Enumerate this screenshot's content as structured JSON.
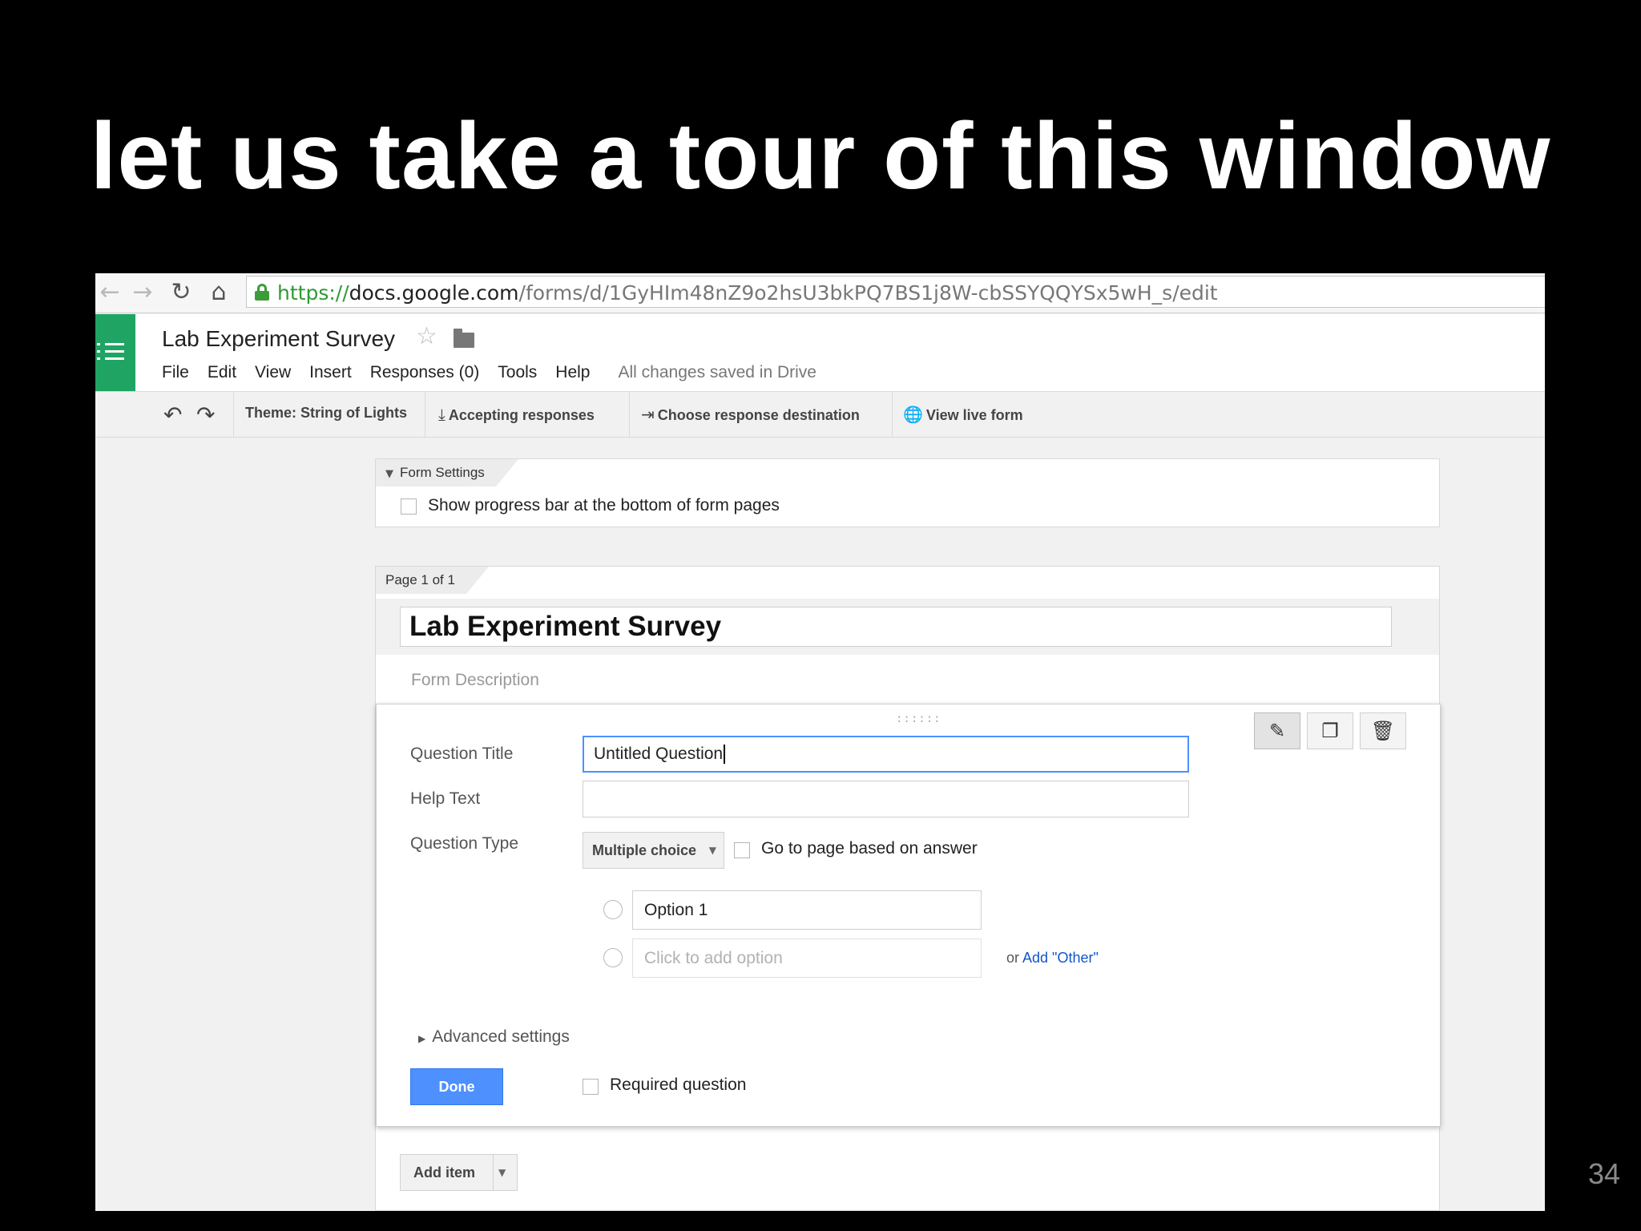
{
  "slide": {
    "title": "let us take a tour of this window",
    "page_number": "34"
  },
  "browser": {
    "url_scheme": "https://",
    "url_host": "docs.google.com",
    "url_path": "/forms/d/1GyHIm48nZ9o2hsU3bkPQ7BS1j8W-cbSSYQQYSx5wH_s/edit",
    "icons": [
      "back-icon",
      "forward-icon",
      "reload-icon",
      "home-icon",
      "lock-icon"
    ]
  },
  "app": {
    "doc_title": "Lab Experiment Survey",
    "menu": [
      "File",
      "Edit",
      "View",
      "Insert",
      "Responses (0)",
      "Tools",
      "Help"
    ],
    "save_status": "All changes saved in Drive",
    "brand_color": "#1fa463"
  },
  "toolbar": {
    "theme": "Theme: String of Lights",
    "accepting": "Accepting responses",
    "destination": "Choose response destination",
    "live_form": "View live form"
  },
  "form_settings": {
    "tab_label": "Form Settings",
    "progress_bar_label": "Show progress bar at the bottom of form pages",
    "progress_bar_checked": false
  },
  "page": {
    "tab_label": "Page 1 of 1",
    "form_title": "Lab Experiment Survey",
    "form_description_placeholder": "Form Description"
  },
  "question": {
    "title_label": "Question Title",
    "title_value": "Untitled Question",
    "help_label": "Help Text",
    "help_value": "",
    "type_label": "Question Type",
    "type_value": "Multiple choice",
    "go_to_page_label": "Go to page based on answer",
    "options": [
      "Option 1"
    ],
    "add_option_placeholder": "Click to add option",
    "or_text": "or",
    "add_other_link": "Add \"Other\"",
    "advanced_settings": "Advanced settings",
    "done_label": "Done",
    "required_label": "Required question",
    "accent_color": "#4d90fe"
  },
  "add_item": {
    "label": "Add item"
  }
}
